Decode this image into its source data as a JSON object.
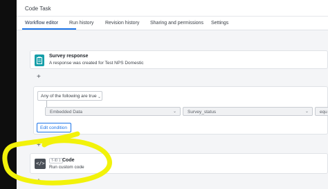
{
  "header": {
    "title": "Code Task"
  },
  "tabs": [
    {
      "label": "Workflow editor",
      "active": true
    },
    {
      "label": "Run history",
      "active": false
    },
    {
      "label": "Revision history",
      "active": false
    },
    {
      "label": "Sharing and permissions",
      "active": false
    },
    {
      "label": "Settings",
      "active": false
    }
  ],
  "trigger_card": {
    "title": "Survey response",
    "subtitle": "A response was created for Test NPS Domestic",
    "icon": "clipboard-icon"
  },
  "condition_card": {
    "match_select": "Any of the following are true",
    "field_source": "Embedded Data",
    "field_name": "Survey_status",
    "operator": "equ",
    "edit_button": "Edit condition"
  },
  "code_card": {
    "badge": "T-ID 1",
    "title": "Code",
    "subtitle": "Run custom code",
    "icon": "code-brackets-icon"
  },
  "add_symbol": "+",
  "colors": {
    "accent": "#1a73e8",
    "trigger_icon_bg": "#169fa9",
    "code_icon_bg": "#4a4f57",
    "annotation": "#f2f20a"
  }
}
